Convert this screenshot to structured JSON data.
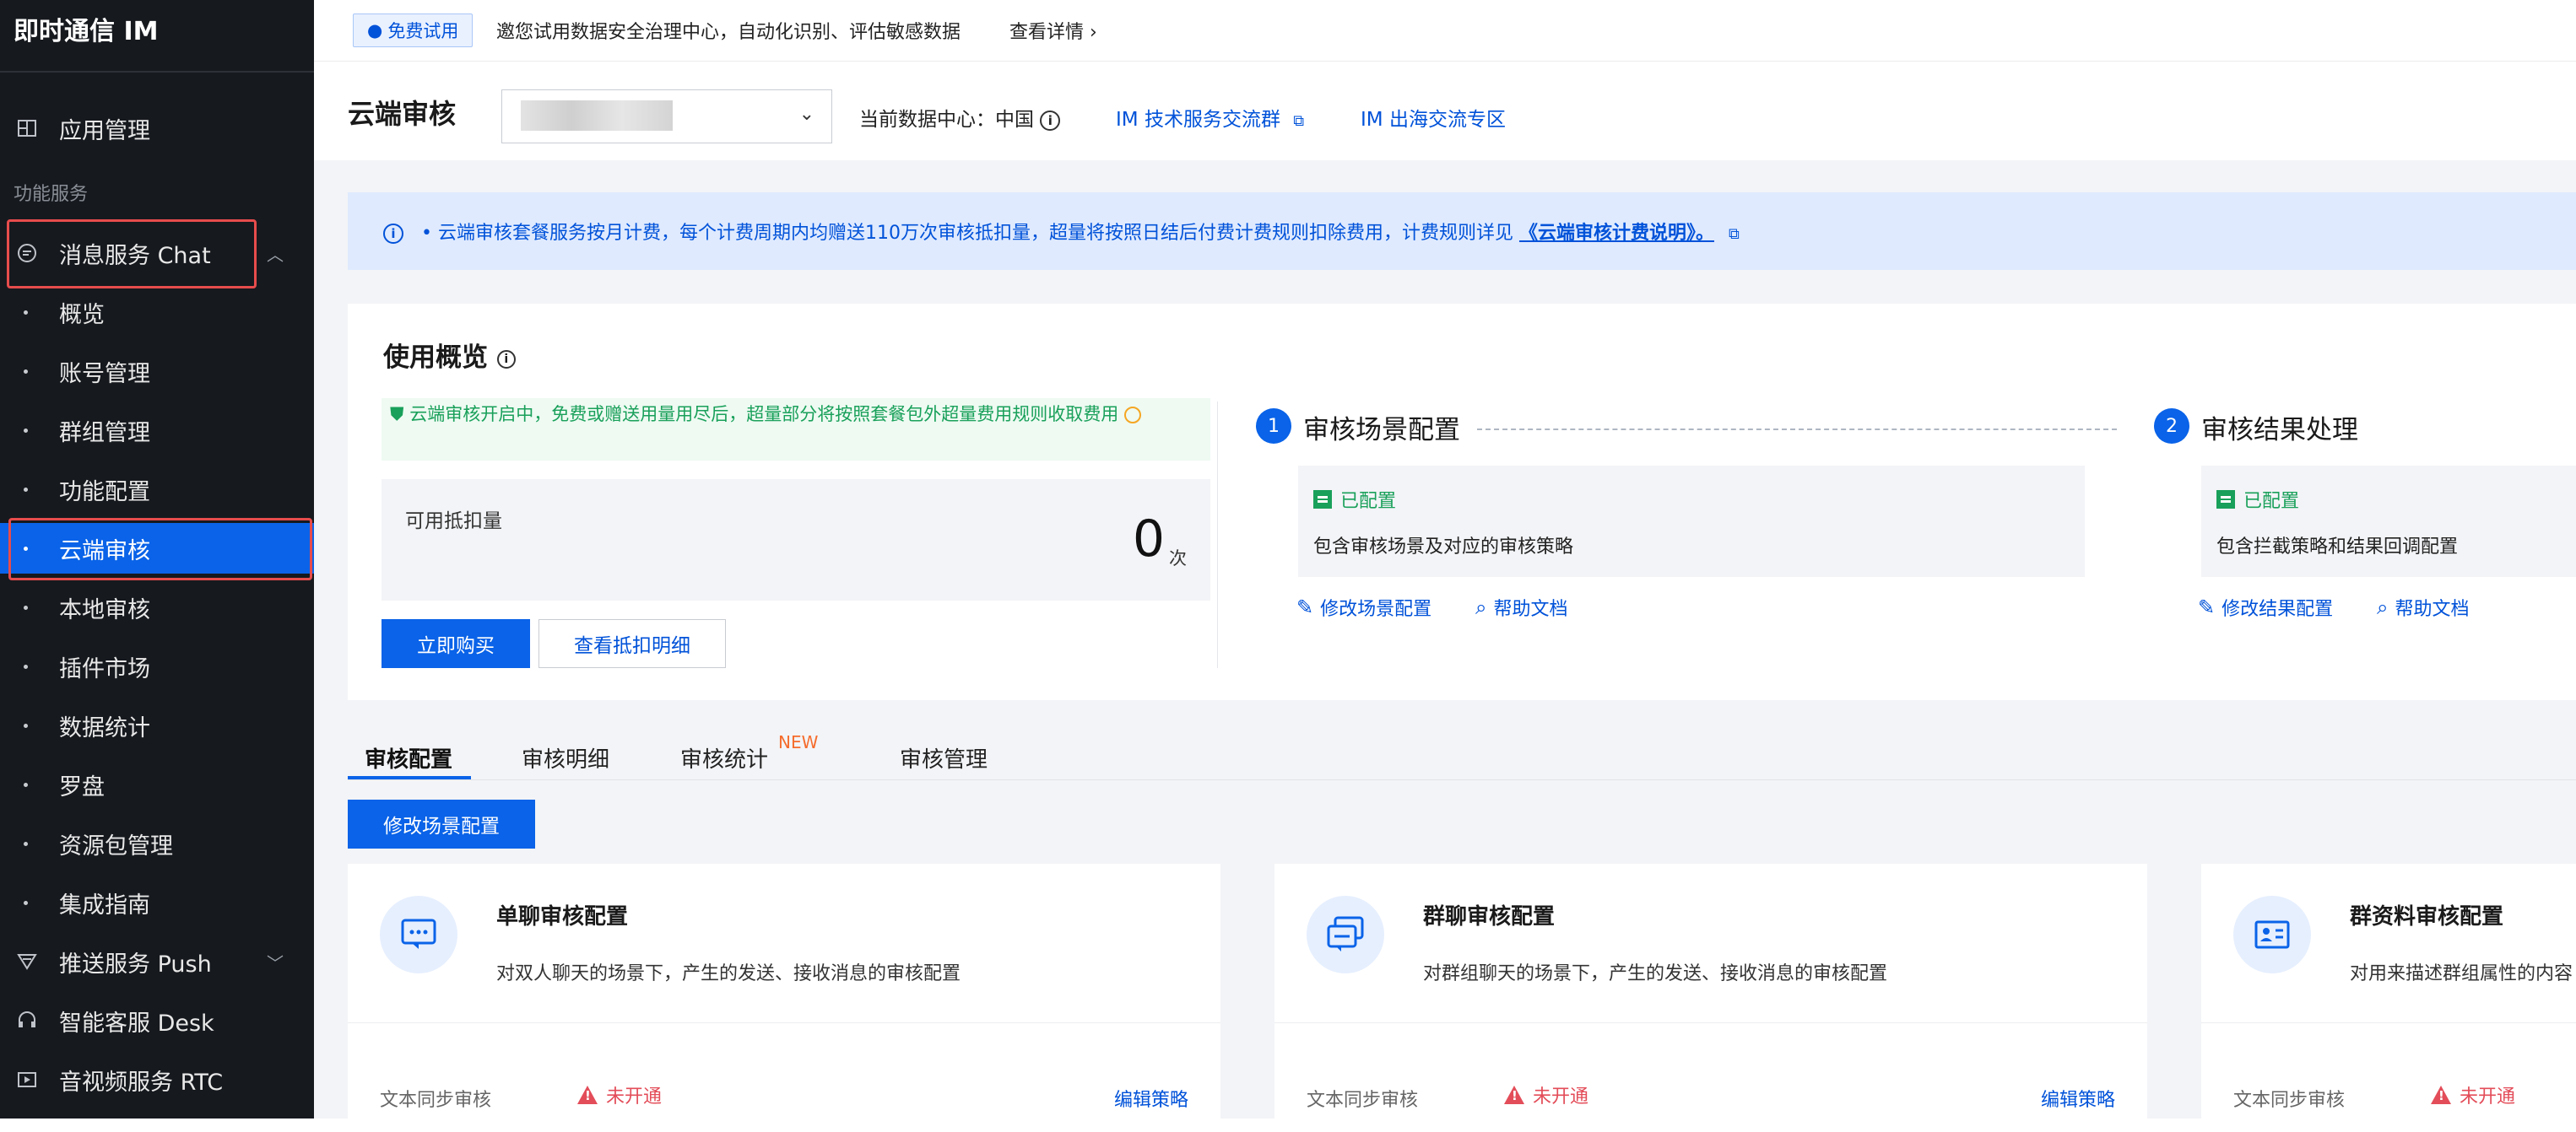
{
  "sidebar": {
    "brand": "即时通信 IM",
    "app_mgmt": "应用管理",
    "group_label": "功能服务",
    "chat": "消息服务 Chat",
    "sub_items": [
      "概览",
      "账号管理",
      "群组管理",
      "功能配置",
      "云端审核",
      "本地审核",
      "插件市场",
      "数据统计",
      "罗盘",
      "资源包管理",
      "集成指南"
    ],
    "push": "推送服务 Push",
    "desk": "智能客服 Desk",
    "rtc": "音视频服务 RTC"
  },
  "notice": {
    "badge": "免费试用",
    "text": "邀您试用数据安全治理中心，自动化识别、评估敏感数据",
    "link": "查看详情 ›"
  },
  "header": {
    "title": "云端审核",
    "data_center": "当前数据中心：中国",
    "link_tech": "IM 技术服务交流群",
    "link_overseas": "IM 出海交流专区"
  },
  "banner": {
    "prefix": "• 云端审核套餐服务按月计费，每个计费周期内均赠送110万次审核抵扣量，超量将按照日结后付费计费规则扣除费用，计费规则详见",
    "link": "《云端审核计费说明》。"
  },
  "usage": {
    "title": "使用概览",
    "note": "云端审核开启中，免费或赠送用量用尽后，超量部分将按照套餐包外超量费用规则收取费用",
    "quota_label": "可用抵扣量",
    "quota_value": "0",
    "quota_unit": "次",
    "buy": "立即购买",
    "detail": "查看抵扣明细"
  },
  "steps": [
    {
      "num": "1",
      "title": "审核场景配置",
      "status": "已配置",
      "desc": "包含审核场景及对应的审核策略",
      "link1": "修改场景配置",
      "link2": "帮助文档"
    },
    {
      "num": "2",
      "title": "审核结果处理",
      "status": "已配置",
      "desc": "包含拦截策略和结果回调配置",
      "link1": "修改结果配置",
      "link2": "帮助文档"
    }
  ],
  "tabs": [
    "审核配置",
    "审核明细",
    "审核统计",
    "审核管理"
  ],
  "new_badge": "NEW",
  "modify_button": "修改场景配置",
  "cards": [
    {
      "title": "单聊审核配置",
      "desc": "对双人聊天的场景下，产生的发送、接收消息的审核配置",
      "key": "文本同步审核",
      "status": "未开通",
      "action": "编辑策略"
    },
    {
      "title": "群聊审核配置",
      "desc": "对群组聊天的场景下，产生的发送、接收消息的审核配置",
      "key": "文本同步审核",
      "status": "未开通",
      "action": "编辑策略"
    },
    {
      "title": "群资料审核配置",
      "desc": "对用来描述群组属性的内容",
      "key": "文本同步审核",
      "status": "未开通",
      "action": ""
    }
  ],
  "colors": {
    "primary": "#0a63e8",
    "sidebar": "#16191e",
    "success": "#19a05a",
    "danger": "#e34d59",
    "highlight_box": "#e74c4c"
  }
}
